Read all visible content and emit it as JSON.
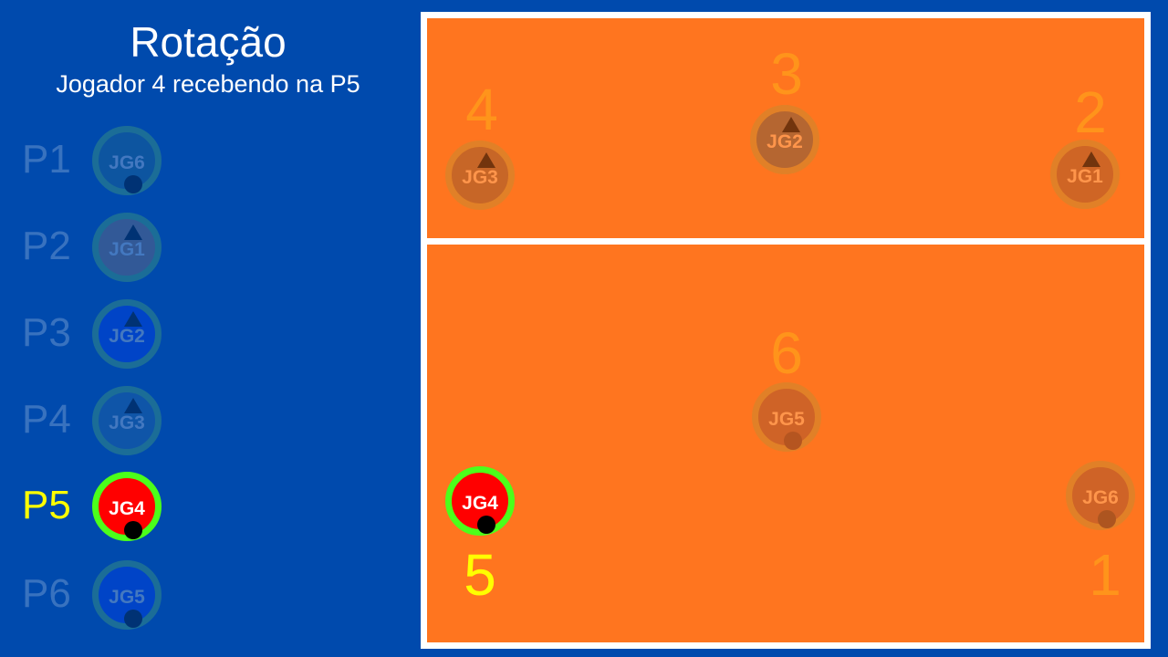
{
  "header": {
    "title": "Rotação",
    "subtitle": "Jogador 4 recebendo na P5"
  },
  "rotation_list": [
    {
      "position": "P1",
      "player": "JG6",
      "marker": "dot",
      "active": false
    },
    {
      "position": "P2",
      "player": "JG1",
      "marker": "triangle",
      "active": false
    },
    {
      "position": "P3",
      "player": "JG2",
      "marker": "triangle",
      "active": false
    },
    {
      "position": "P4",
      "player": "JG3",
      "marker": "triangle",
      "active": false
    },
    {
      "position": "P5",
      "player": "JG4",
      "marker": "dot",
      "active": true
    },
    {
      "position": "P6",
      "player": "JG5",
      "marker": "dot",
      "active": false
    }
  ],
  "court": {
    "front_row": [
      {
        "zone": "4",
        "player": "JG3",
        "marker": "triangle"
      },
      {
        "zone": "3",
        "player": "JG2",
        "marker": "triangle"
      },
      {
        "zone": "2",
        "player": "JG1",
        "marker": "triangle"
      }
    ],
    "back_row": [
      {
        "zone": "6",
        "player": "JG5",
        "marker": "dot"
      },
      {
        "zone": "5",
        "player": "JG4",
        "marker": "dot",
        "active": true
      },
      {
        "zone": "1",
        "player": "JG6",
        "marker": "dot"
      }
    ]
  },
  "colors": {
    "background": "#004aad",
    "court": "#ff751f",
    "active_player": "#ff0000",
    "active_ring": "#4cff1a",
    "active_label": "#ffff00"
  }
}
